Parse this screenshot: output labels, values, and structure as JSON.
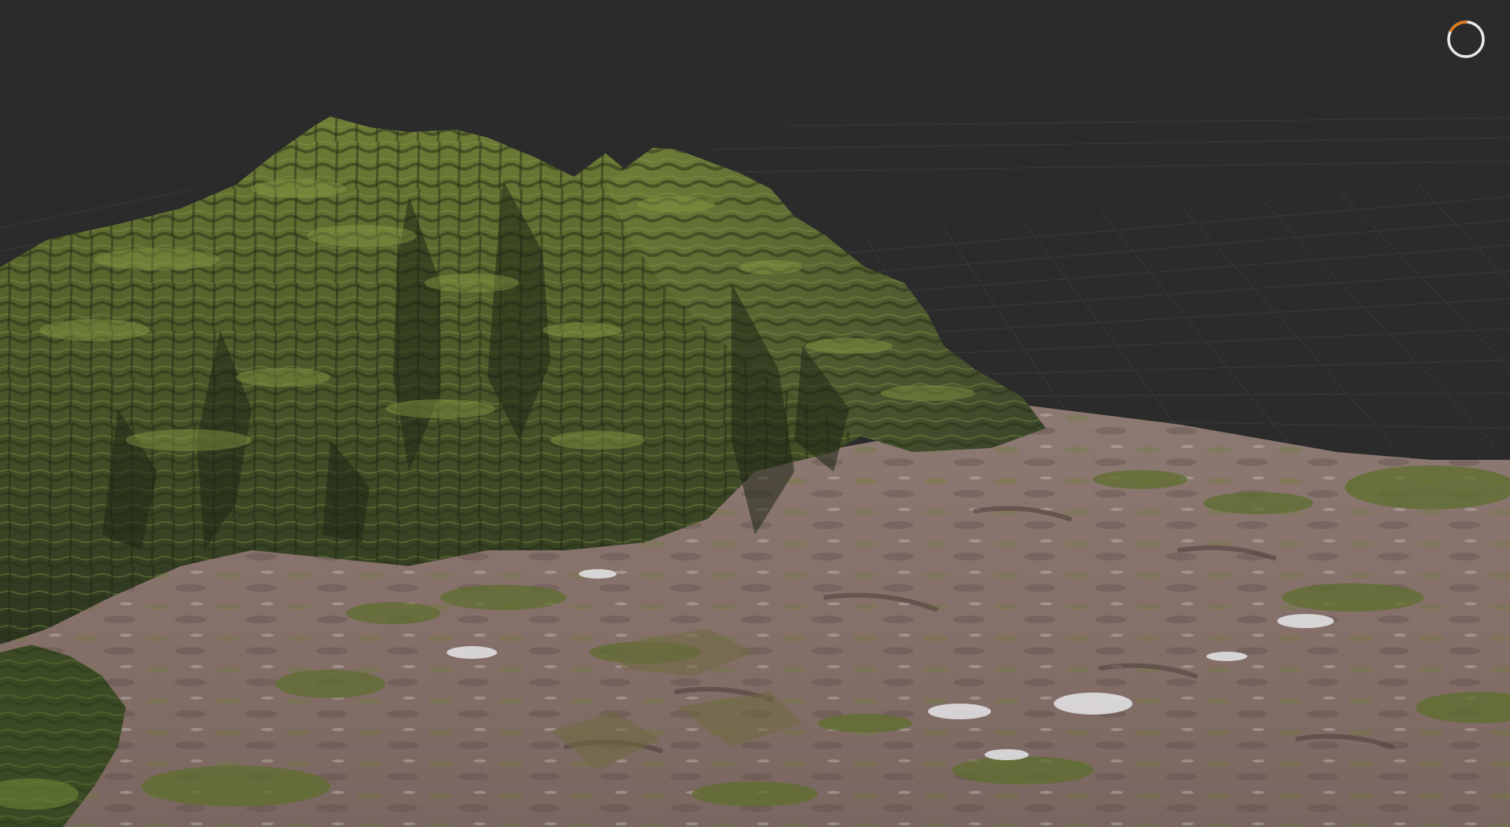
{
  "viewport": {
    "background_color": "#2b2b2b",
    "grid_color": "#3a3a3a"
  },
  "terrain": {
    "mountain_color": "#4d5a2a",
    "mountain_highlight": "#7a8a3c",
    "mountain_shadow": "#26301a",
    "plain_color": "#8a7470",
    "plain_highlight": "#b8a8a0",
    "snow_color": "#e6e6ea"
  },
  "loading_indicator": {
    "icon": "loading-spinner-icon",
    "ring_color": "#e8e8e8",
    "accent_color": "#e07a1a"
  }
}
